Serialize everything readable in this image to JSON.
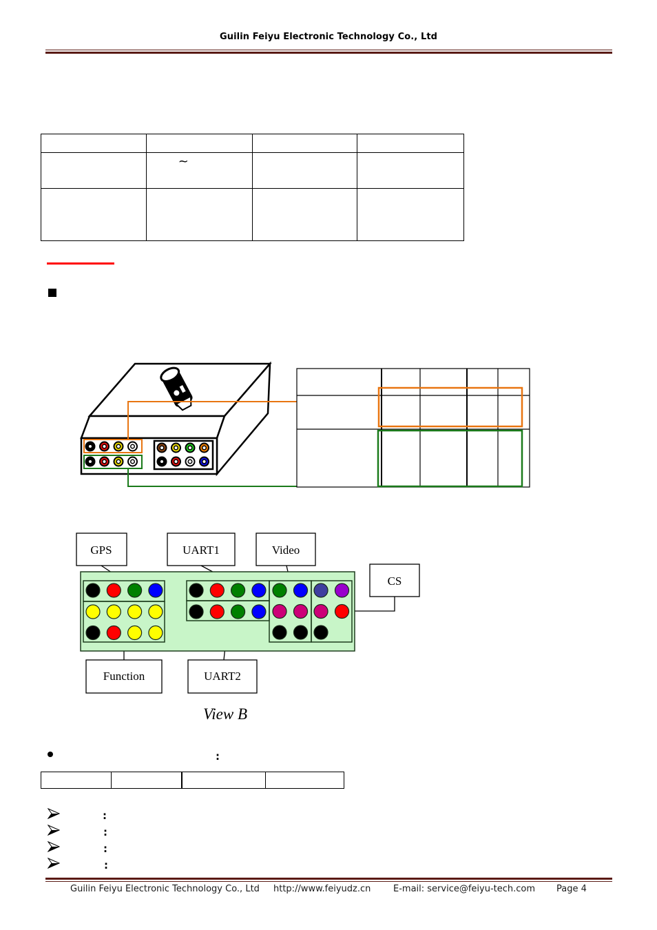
{
  "header": {
    "title": "Guilin Feiyu Electronic Technology Co., Ltd"
  },
  "spec_table": {
    "rows": [
      [
        "",
        "",
        "",
        ""
      ],
      [
        "",
        "~",
        "",
        ""
      ],
      [
        "",
        "",
        "",
        ""
      ]
    ]
  },
  "section_bullet": {
    "icon": "square-bullet-icon"
  },
  "connector_figure": {
    "device": "gimbal-controller-box",
    "left_connector_group": {
      "top_row_colors": [
        "#000000",
        "#e01010",
        "#e8d800",
        "#ffffff"
      ],
      "bottom_row_colors": [
        "#000000",
        "#e01010",
        "#e8d800",
        "#ffffff"
      ]
    },
    "right_connector_group": {
      "top_row_colors": [
        "#8b4513",
        "#e8d800",
        "#22cc22",
        "#f08000"
      ],
      "bottom_row_colors": [
        "#000000",
        "#e01010",
        "#ffffff",
        "#1010e0"
      ]
    },
    "highlight_colors": {
      "orange": "#e87511",
      "green": "#1a7a1a"
    },
    "pin_table": {
      "rows": [
        [
          "",
          "",
          "",
          "",
          ""
        ],
        [
          "",
          "",
          "",
          "",
          ""
        ],
        [
          "",
          "",
          "",
          "",
          ""
        ]
      ]
    }
  },
  "view_b": {
    "caption": "View B",
    "labels": {
      "gps": "GPS",
      "uart1": "UART1",
      "video": "Video",
      "cs": "CS",
      "function": "Function",
      "uart2": "UART2"
    },
    "panel_bg": "#c8f5c8",
    "gps_row": [
      "#000000",
      "#ff0000",
      "#008000",
      "#0000ff"
    ],
    "function_rows": [
      [
        "#ffff00",
        "#ffff00",
        "#ffff00",
        "#ffff00"
      ],
      [
        "#000000",
        "#ff0000",
        "#ffff00",
        "#ffff00"
      ]
    ],
    "uart1_row": [
      "#000000",
      "#ff0000",
      "#008000",
      "#0000ff"
    ],
    "uart2_row": [
      "#000000",
      "#ff0000",
      "#008000",
      "#0000ff"
    ],
    "video_rows": [
      [
        "#008000",
        "#0000ff"
      ],
      [
        "#cc0077",
        "#cc0077"
      ],
      [
        "#000000",
        "#000000"
      ]
    ],
    "cs_rows": [
      [
        "#3f3f9f",
        "#9900cc"
      ],
      [
        "#cc0077",
        "#ff0000"
      ],
      [
        "#000000"
      ]
    ]
  },
  "bullet_section": {
    "colon": ":",
    "table_cells": [
      "",
      "",
      "",
      ""
    ]
  },
  "arrow_list": {
    "items": [
      {
        "label": "",
        "colon": ":"
      },
      {
        "label": "",
        "colon": ":"
      },
      {
        "label": "",
        "colon": ":"
      },
      {
        "label": "",
        "colon": ":"
      }
    ]
  },
  "footer": {
    "company": "Guilin Feiyu Electronic Technology Co., Ltd",
    "website": "http://www.feiyudz.cn",
    "email": "E-mail: service@feiyu-tech.com",
    "page": "Page 4"
  }
}
